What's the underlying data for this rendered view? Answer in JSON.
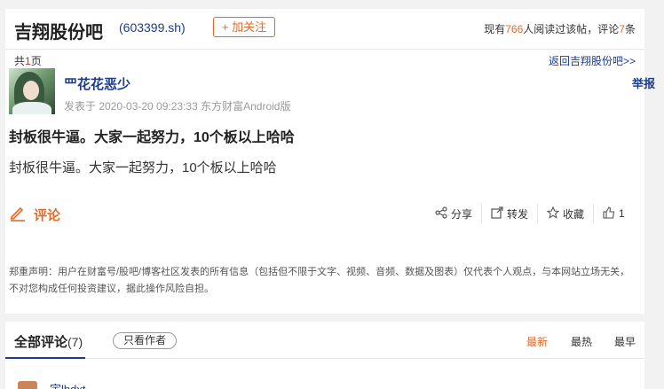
{
  "header": {
    "bar_title": "吉翔股份吧",
    "stock_code": "(603399.sh)",
    "follow_label": "+ 加关注",
    "stats_prefix": "现有",
    "readers": "766",
    "stats_mid": "人阅读过该帖，评论",
    "comments": "7",
    "stats_suffix": "条"
  },
  "subhead": {
    "pages_prefix": "共",
    "pages": "1",
    "pages_suffix": "页",
    "back_link": "返回吉翔股份吧>>"
  },
  "post": {
    "author": "罒花花恶少",
    "meta": "发表于 2020-03-20 09:23:33 东方财富Android版",
    "report": "举报",
    "title": "封板很牛逼。大家一起努力，10个板以上哈哈",
    "body": "封板很牛逼。大家一起努力，10个板以上哈哈"
  },
  "actions": {
    "comment": "评论",
    "share": "分享",
    "repost": "转发",
    "favorite": "收藏",
    "like_count": "1"
  },
  "disclaimer": "郑重声明：用户在财富号/股吧/博客社区发表的所有信息（包括但不限于文字、视频、音频、数据及图表）仅代表个人观点，与本网站立场无关，不对您构成任何投资建议，据此操作风险自担。",
  "comments_section": {
    "title": "全部评论",
    "count": "(7)",
    "author_only": "只看作者",
    "sort_newest": "最新",
    "sort_hottest": "最热",
    "sort_earliest": "最早",
    "first_commenter": "宇lbdxt"
  },
  "colors": {
    "accent": "#e06b2c",
    "link": "#1a3b8f"
  },
  "icons": [
    "pencil-icon",
    "share-icon",
    "repost-icon",
    "star-icon",
    "thumbs-up-icon"
  ]
}
